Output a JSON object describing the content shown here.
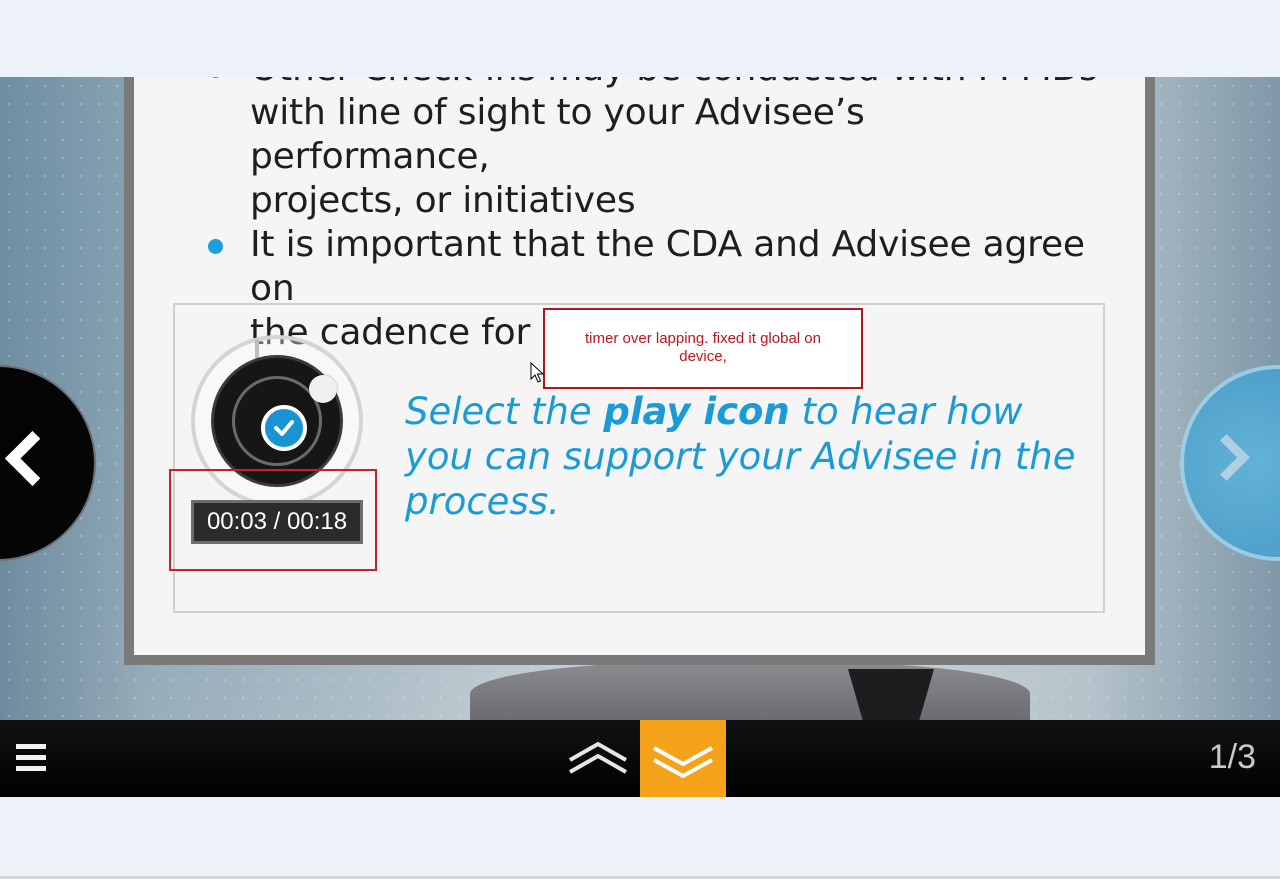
{
  "slide": {
    "bullets": [
      {
        "lines": [
          "Other Check-ins may be conducted with PPMDs",
          "with line of sight to your Advisee’s performance,",
          "projects, or initiatives"
        ]
      },
      {
        "lines": [
          "It is important that the CDA and Advisee agree on",
          "the cadence for Check-ins"
        ]
      }
    ],
    "instruction": {
      "prefix": "Select the ",
      "emphasis": "play icon",
      "suffix": " to hear how you can support your Advisee in the process."
    }
  },
  "audio_player": {
    "time_display": "00:03 / 00:18",
    "progress_fraction": 0.17
  },
  "annotation": {
    "comment_text": "timer over lapping. fixed it global on device,",
    "color": "#c0141c"
  },
  "navigation": {
    "page_counter": "1/3",
    "menu_icon": "hamburger-menu-icon",
    "prev_icon": "chevron-left-icon",
    "next_icon": "chevron-right-icon",
    "up_icon": "double-chevron-up-icon",
    "down_icon": "double-chevron-down-icon",
    "accent_color": "#f5a21b"
  },
  "colors": {
    "bullet_blue": "#1aa0dc",
    "play_blue": "#1994d3"
  }
}
